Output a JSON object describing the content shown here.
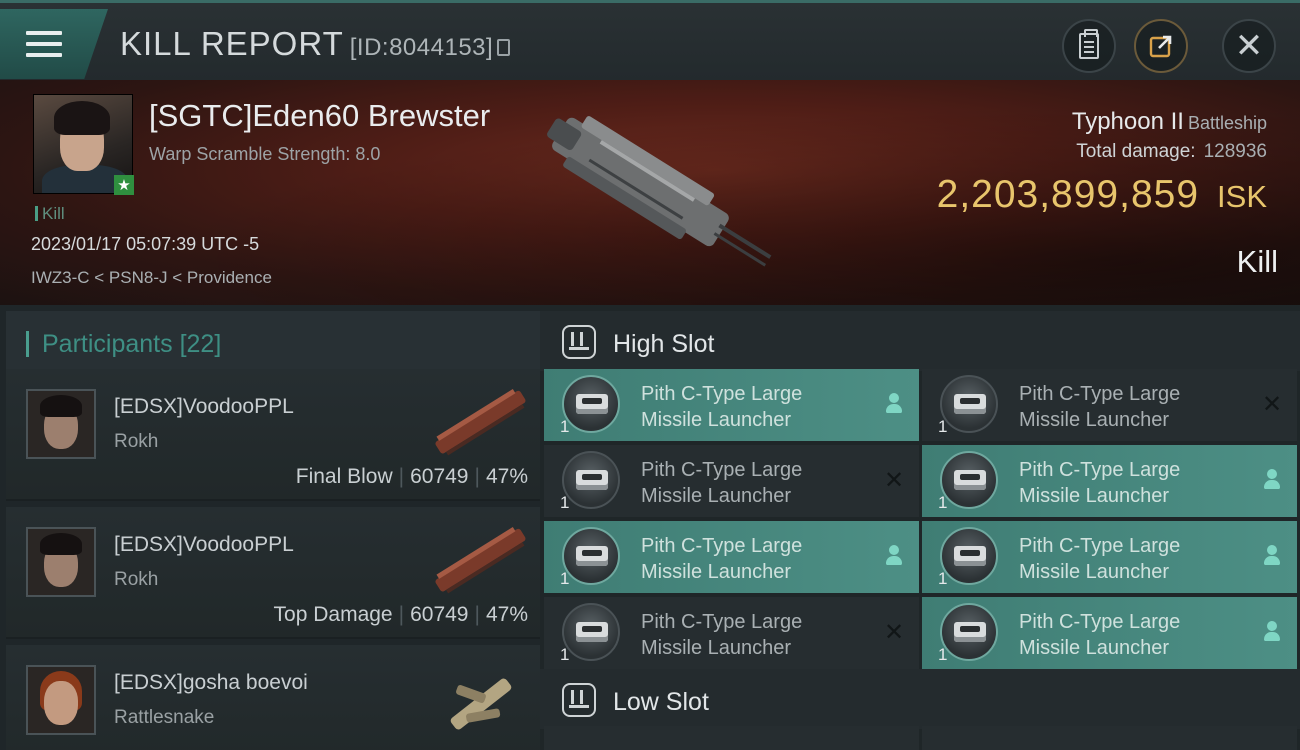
{
  "header": {
    "title": "KILL REPORT",
    "id_text": "[ID:8044153]",
    "icons": {
      "menu": "hamburger-menu-icon",
      "copy": "copy-icon",
      "clipboard": "clipboard-icon",
      "share": "share-icon",
      "close": "close-icon"
    }
  },
  "victim": {
    "name": "[SGTC]Eden60 Brewster",
    "warp_scramble": "Warp Scramble Strength: 8.0",
    "tag": "Kill",
    "datetime": "2023/01/17 05:07:39 UTC -5",
    "location": "IWZ3-C < PSN8-J < Providence",
    "ship_name": "Typhoon II",
    "ship_class": "Battleship",
    "total_damage_label": "Total damage:",
    "total_damage": "128936",
    "isk_value": "2,203,899,859",
    "isk_unit": "ISK",
    "result": "Kill"
  },
  "participants": {
    "label": "Participants",
    "count": "[22]",
    "rows": [
      {
        "name": "[EDSX]VoodooPPL",
        "ship": "Rokh",
        "role": "Final Blow",
        "damage": "60749",
        "percent": "47%"
      },
      {
        "name": "[EDSX]VoodooPPL",
        "ship": "Rokh",
        "role": "Top Damage",
        "damage": "60749",
        "percent": "47%"
      },
      {
        "name": "[EDSX]gosha boevoi",
        "ship": "Rattlesnake",
        "role": "",
        "damage": "",
        "percent": ""
      }
    ]
  },
  "fitting": {
    "high_slot_label": "High Slot",
    "low_slot_label": "Low Slot",
    "high_slots": [
      {
        "line1": "Pith C-Type Large",
        "line2": "Missile Launcher",
        "qty": "1",
        "state": "dropped"
      },
      {
        "line1": "Pith C-Type Large",
        "line2": "Missile Launcher",
        "qty": "1",
        "state": "destroyed"
      },
      {
        "line1": "Pith C-Type Large",
        "line2": "Missile Launcher",
        "qty": "1",
        "state": "destroyed"
      },
      {
        "line1": "Pith C-Type Large",
        "line2": "Missile Launcher",
        "qty": "1",
        "state": "dropped"
      },
      {
        "line1": "Pith C-Type Large",
        "line2": "Missile Launcher",
        "qty": "1",
        "state": "dropped"
      },
      {
        "line1": "Pith C-Type Large",
        "line2": "Missile Launcher",
        "qty": "1",
        "state": "dropped"
      },
      {
        "line1": "Pith C-Type Large",
        "line2": "Missile Launcher",
        "qty": "1",
        "state": "destroyed"
      },
      {
        "line1": "Pith C-Type Large",
        "line2": "Missile Launcher",
        "qty": "1",
        "state": "dropped"
      }
    ]
  },
  "colors": {
    "accent_teal": "#4d8f85",
    "isk_gold": "#e8c56c",
    "banner_red": "#4e1d16"
  }
}
